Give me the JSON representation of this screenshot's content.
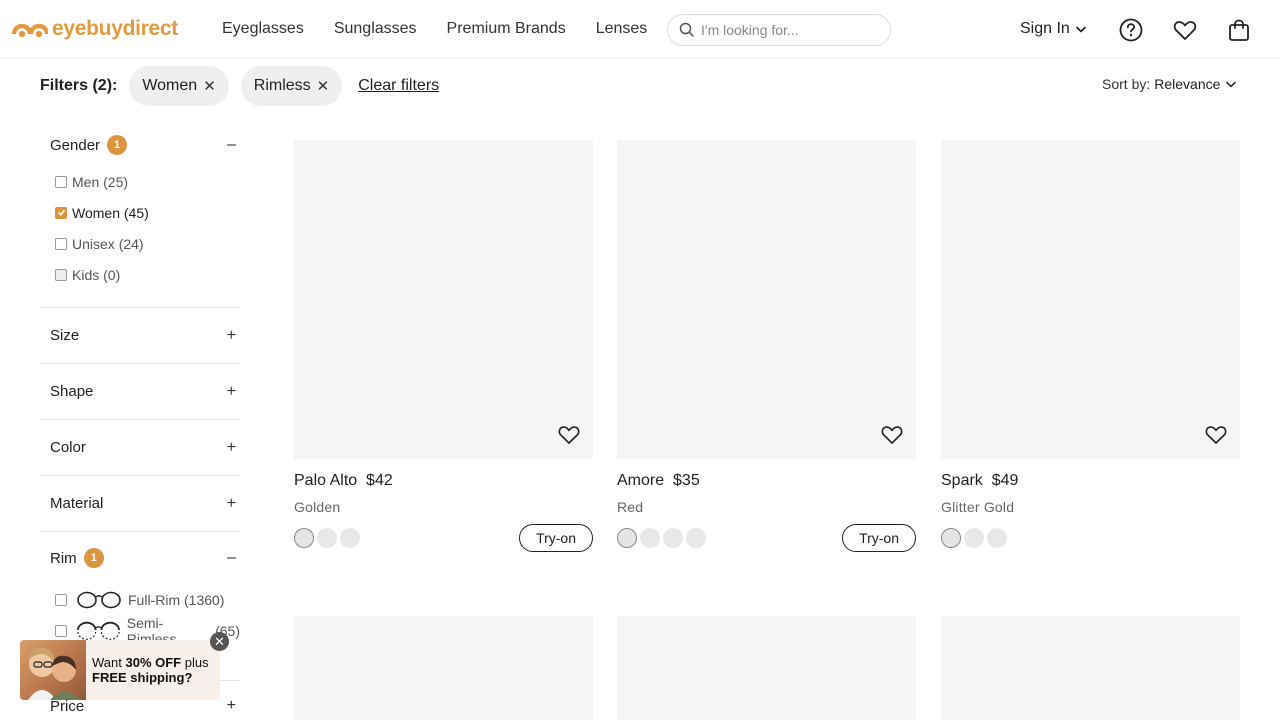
{
  "header": {
    "logo_text": "eyebuydirect",
    "nav": [
      "Eyeglasses",
      "Sunglasses",
      "Premium Brands",
      "Lenses"
    ],
    "search_placeholder": "I'm looking for...",
    "sign_in": "Sign In",
    "icons": [
      "help-icon",
      "heart-icon",
      "cart-icon"
    ]
  },
  "filterbar": {
    "label": "Filters (2):",
    "chips": [
      "Women",
      "Rimless"
    ],
    "clear": "Clear filters",
    "sort_prefix": "Sort by:",
    "sort_value": "Relevance"
  },
  "sidebar": {
    "gender": {
      "title": "Gender",
      "count": "1",
      "options": [
        {
          "label": "Men",
          "count": "(25)",
          "checked": false
        },
        {
          "label": "Women",
          "count": "(45)",
          "checked": true
        },
        {
          "label": "Unisex",
          "count": "(24)",
          "checked": false
        },
        {
          "label": "Kids",
          "count": "(0)",
          "checked": false
        }
      ]
    },
    "sections": [
      "Size",
      "Shape",
      "Color",
      "Material"
    ],
    "rim": {
      "title": "Rim",
      "count": "1",
      "options": [
        {
          "label": "Full-Rim",
          "count": "(1360)"
        },
        {
          "label": "Semi-Rimless",
          "count": "(65)"
        }
      ]
    },
    "price": "Price"
  },
  "products": [
    {
      "name": "Palo Alto",
      "price": "$42",
      "color": "Golden",
      "swatches": 3,
      "tryon": "Try-on"
    },
    {
      "name": "Amore",
      "price": "$35",
      "color": "Red",
      "swatches": 4,
      "tryon": "Try-on"
    },
    {
      "name": "Spark",
      "price": "$49",
      "color": "Glitter Gold",
      "swatches": 3,
      "tryon": ""
    }
  ],
  "promo": {
    "text_bold": "30% OFF",
    "line1_prefix": "Want",
    "line1_suffix": "plus",
    "line2": "FREE shipping?"
  },
  "colors": {
    "brand": "#e29a3f",
    "badge": "#d9953f",
    "placeholder_bg": "#f5f5f5"
  }
}
